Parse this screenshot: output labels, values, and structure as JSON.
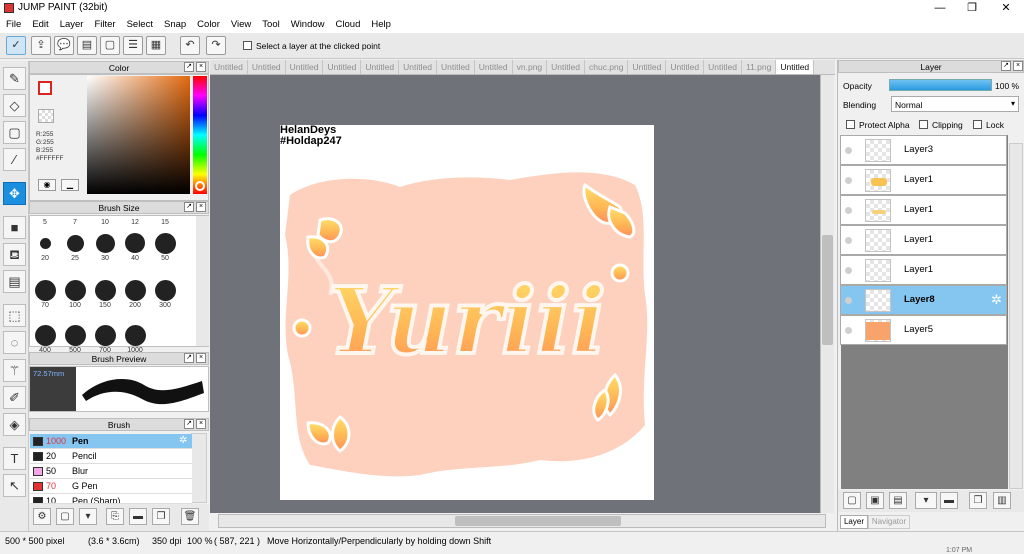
{
  "window": {
    "title": "JUMP PAINT (32bit)",
    "minimize": "—",
    "restore": "❐",
    "close": "✕"
  },
  "menu": [
    "File",
    "Edit",
    "Layer",
    "Filter",
    "Select",
    "Snap",
    "Color",
    "View",
    "Tool",
    "Window",
    "Cloud",
    "Help"
  ],
  "toolbar": {
    "select_layer_label": "Select a layer at the clicked point"
  },
  "color_panel": {
    "title": "Color",
    "r": "R:255",
    "g": "G:255",
    "b": "B:255",
    "hex": "#FFFFFF"
  },
  "brush_size_panel": {
    "title": "Brush Size",
    "top_labels": [
      "5",
      "7",
      "10",
      "12",
      "15"
    ],
    "rows": [
      [
        "20",
        "25",
        "30",
        "40",
        "50"
      ],
      [
        "70",
        "100",
        "150",
        "200",
        "300"
      ],
      [
        "400",
        "500",
        "700",
        "1000"
      ]
    ]
  },
  "brush_preview_panel": {
    "title": "Brush Preview",
    "size": "72.57mm"
  },
  "brush_panel": {
    "title": "Brush",
    "items": [
      {
        "num": "1000",
        "name": "Pen",
        "color": "#222222"
      },
      {
        "num": "20",
        "name": "Pencil",
        "color": "#222222"
      },
      {
        "num": "50",
        "name": "Blur",
        "color": "#f4a6e6"
      },
      {
        "num": "70",
        "name": "G Pen",
        "color": "#e33333"
      },
      {
        "num": "10",
        "name": "Pen (Sharp)",
        "color": "#222222"
      }
    ]
  },
  "tabs": [
    "Untitled",
    "Untitled",
    "Untitled",
    "Untitled",
    "Untitled",
    "Untitled",
    "Untitled",
    "Untitled",
    "vn.png",
    "Untitled",
    "chuc.png",
    "Untitled",
    "Untitled",
    "Untitled",
    "11.png",
    "Untitled"
  ],
  "canvas": {
    "watermark_line1": "HelanDeys",
    "watermark_line2": "#Holdap247",
    "art_text": "Yuriii"
  },
  "layer_panel": {
    "title": "Layer",
    "opacity_label": "Opacity",
    "opacity_value": "100 %",
    "opacity_fraction": 1.0,
    "blending_label": "Blending",
    "blending_value": "Normal",
    "protect_alpha": "Protect Alpha",
    "clipping": "Clipping",
    "lock": "Lock",
    "layers": [
      "Layer3",
      "Layer1",
      "Layer1",
      "Layer1",
      "Layer1",
      "Layer8",
      "Layer5"
    ],
    "selected": "Layer8",
    "tab_layer": "Layer",
    "tab_navigator": "Navigator"
  },
  "status": {
    "size": "500 * 500 pixel",
    "cm": "(3.6 * 3.6cm)",
    "dpi": "350 dpi",
    "zoom": "100 %",
    "coords": "( 587, 221 )",
    "hint": "Move Horizontally/Perpendicularly by holding down Shift",
    "clock": "1:07 PM"
  }
}
